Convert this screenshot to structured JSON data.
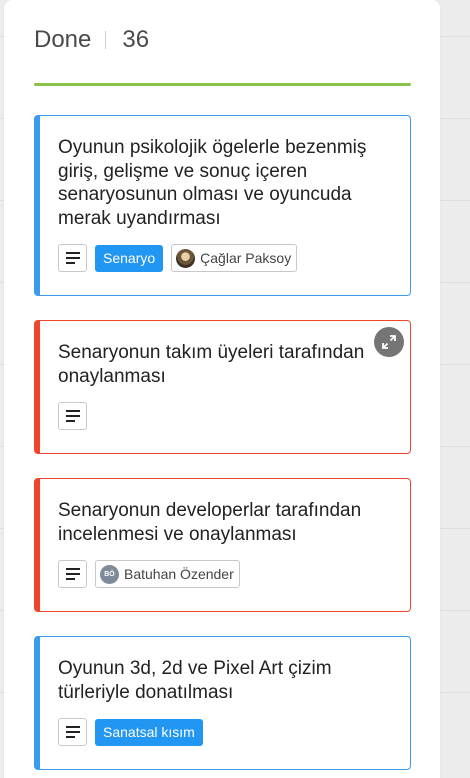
{
  "column": {
    "title": "Done",
    "count": "36"
  },
  "colors": {
    "done_underline": "#8bc34a",
    "blue_card": "#3a9bf0",
    "red_card": "#f0452c",
    "label_blue": "#2196f3"
  },
  "cards": [
    {
      "title": "Oyunun psikolojik ögelerle bezenmiş giriş, gelişme ve sonuç içeren senaryosunun olması ve oyuncuda merak uyandırması",
      "label": "Senaryo",
      "member": "Çağlar Paksoy",
      "color": "blue"
    },
    {
      "title": " Senaryonun takım üyeleri tarafından onaylanması",
      "color": "red"
    },
    {
      "title": " Senaryonun developerlar tarafından incelenmesi ve onaylanması",
      "member": "Batuhan Özender",
      "member_initials": "BÖ",
      "color": "red"
    },
    {
      "title": "Oyunun 3d, 2d ve Pixel Art çizim türleriyle donatılması",
      "label": "Sanatsal kısım",
      "color": "blue"
    }
  ]
}
